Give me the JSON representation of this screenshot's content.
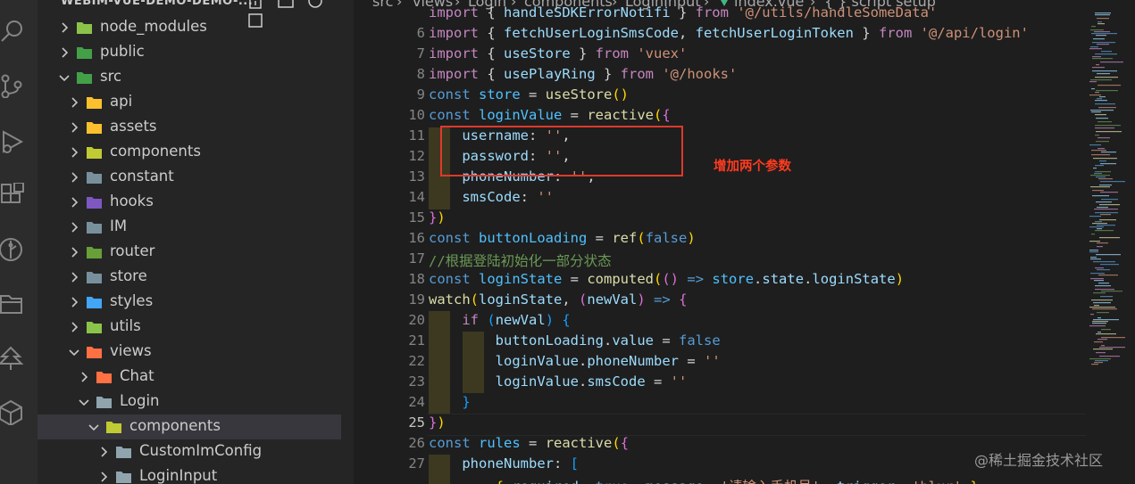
{
  "activity_bar": [
    "search-icon",
    "source-control-icon",
    "run-debug-icon",
    "extensions-icon",
    "git-graph-icon",
    "folder-icon",
    "tree-icon",
    "box-icon"
  ],
  "explorer": {
    "title": "WEBIM-VUE-DEMO-DEMO-...",
    "items": [
      {
        "label": "node_modules",
        "indent": 0,
        "chevron": "right",
        "icon": "#8bc34a"
      },
      {
        "label": "public",
        "indent": 0,
        "chevron": "right",
        "icon": "#43a047"
      },
      {
        "label": "src",
        "indent": 0,
        "chevron": "down",
        "icon": "#43a047"
      },
      {
        "label": "api",
        "indent": 1,
        "chevron": "right",
        "icon": "#fbc02d"
      },
      {
        "label": "assets",
        "indent": 1,
        "chevron": "right",
        "icon": "#fbc02d"
      },
      {
        "label": "components",
        "indent": 1,
        "chevron": "right",
        "icon": "#c0ca33"
      },
      {
        "label": "constant",
        "indent": 1,
        "chevron": "right",
        "icon": "#78909c"
      },
      {
        "label": "hooks",
        "indent": 1,
        "chevron": "right",
        "icon": "#7e57c2"
      },
      {
        "label": "IM",
        "indent": 1,
        "chevron": "right",
        "icon": "#78909c"
      },
      {
        "label": "router",
        "indent": 1,
        "chevron": "right",
        "icon": "#689f38"
      },
      {
        "label": "store",
        "indent": 1,
        "chevron": "right",
        "icon": "#78909c"
      },
      {
        "label": "styles",
        "indent": 1,
        "chevron": "right",
        "icon": "#42a5f5"
      },
      {
        "label": "utils",
        "indent": 1,
        "chevron": "right",
        "icon": "#8bc34a"
      },
      {
        "label": "views",
        "indent": 1,
        "chevron": "down",
        "icon": "#ff7043"
      },
      {
        "label": "Chat",
        "indent": 2,
        "chevron": "right",
        "icon": "#ff7043"
      },
      {
        "label": "Login",
        "indent": 2,
        "chevron": "down",
        "icon": "#90a4ae"
      },
      {
        "label": "components",
        "indent": 3,
        "chevron": "down",
        "icon": "#c0ca33",
        "selected": true
      },
      {
        "label": "CustomImConfig",
        "indent": 4,
        "chevron": "right",
        "icon": "#90a4ae"
      },
      {
        "label": "LoginInput",
        "indent": 4,
        "chevron": "right",
        "icon": "#90a4ae"
      }
    ]
  },
  "breadcrumb": [
    "src",
    "views",
    "Login",
    "components",
    "LoginInput",
    "index.vue",
    "{ } script setup"
  ],
  "code": {
    "active_line": 25,
    "lines": [
      {
        "n": "",
        "tokens": [
          [
            "kw2",
            "import"
          ],
          [
            "pun",
            " { "
          ],
          [
            "var",
            "handleSDKErrorNotifi"
          ],
          [
            "pun",
            " } "
          ],
          [
            "kw2",
            "from"
          ],
          [
            "pun",
            " "
          ],
          [
            "str",
            "'@/utils/handleSomeData'"
          ]
        ]
      },
      {
        "n": "6",
        "tokens": [
          [
            "kw2",
            "import"
          ],
          [
            "pun",
            " { "
          ],
          [
            "var",
            "fetchUserLoginSmsCode"
          ],
          [
            "pun",
            ", "
          ],
          [
            "var",
            "fetchUserLoginToken"
          ],
          [
            "pun",
            " } "
          ],
          [
            "kw2",
            "from"
          ],
          [
            "pun",
            " "
          ],
          [
            "str",
            "'@/api/login'"
          ]
        ]
      },
      {
        "n": "7",
        "tokens": [
          [
            "kw2",
            "import"
          ],
          [
            "pun",
            " { "
          ],
          [
            "var",
            "useStore"
          ],
          [
            "pun",
            " } "
          ],
          [
            "kw2",
            "from"
          ],
          [
            "pun",
            " "
          ],
          [
            "str",
            "'vuex'"
          ]
        ]
      },
      {
        "n": "8",
        "tokens": [
          [
            "kw2",
            "import"
          ],
          [
            "pun",
            " { "
          ],
          [
            "var",
            "usePlayRing"
          ],
          [
            "pun",
            " } "
          ],
          [
            "kw2",
            "from"
          ],
          [
            "pun",
            " "
          ],
          [
            "str",
            "'@/hooks'"
          ]
        ]
      },
      {
        "n": "9",
        "tokens": [
          [
            "kw",
            "const"
          ],
          [
            "pun",
            " "
          ],
          [
            "cst",
            "store"
          ],
          [
            "pun",
            " = "
          ],
          [
            "fn",
            "useStore"
          ],
          [
            "brk",
            "()"
          ]
        ]
      },
      {
        "n": "10",
        "tokens": [
          [
            "kw",
            "const"
          ],
          [
            "pun",
            " "
          ],
          [
            "cst",
            "loginValue"
          ],
          [
            "pun",
            " = "
          ],
          [
            "fn",
            "reactive"
          ],
          [
            "brk",
            "("
          ],
          [
            "brk2",
            "{"
          ]
        ]
      },
      {
        "n": "11",
        "tokens": [
          [
            "pun",
            "    "
          ],
          [
            "var",
            "username"
          ],
          [
            "pun",
            ": "
          ],
          [
            "str",
            "''"
          ],
          [
            "pun",
            ","
          ]
        ]
      },
      {
        "n": "12",
        "tokens": [
          [
            "pun",
            "    "
          ],
          [
            "var",
            "password"
          ],
          [
            "pun",
            ": "
          ],
          [
            "str",
            "''"
          ],
          [
            "pun",
            ","
          ]
        ]
      },
      {
        "n": "13",
        "tokens": [
          [
            "pun",
            "    "
          ],
          [
            "var",
            "phoneNumber"
          ],
          [
            "pun",
            ": "
          ],
          [
            "str",
            "''"
          ],
          [
            "pun",
            ","
          ]
        ]
      },
      {
        "n": "14",
        "tokens": [
          [
            "pun",
            "    "
          ],
          [
            "var",
            "smsCode"
          ],
          [
            "pun",
            ": "
          ],
          [
            "str",
            "''"
          ]
        ]
      },
      {
        "n": "15",
        "tokens": [
          [
            "brk2",
            "}"
          ],
          [
            "brk",
            ")"
          ]
        ]
      },
      {
        "n": "16",
        "tokens": [
          [
            "kw",
            "const"
          ],
          [
            "pun",
            " "
          ],
          [
            "cst",
            "buttonLoading"
          ],
          [
            "pun",
            " = "
          ],
          [
            "fn",
            "ref"
          ],
          [
            "brk",
            "("
          ],
          [
            "kw",
            "false"
          ],
          [
            "brk",
            ")"
          ]
        ]
      },
      {
        "n": "17",
        "tokens": [
          [
            "cmt",
            "//根据登陆初始化一部分状态"
          ]
        ]
      },
      {
        "n": "18",
        "tokens": [
          [
            "kw",
            "const"
          ],
          [
            "pun",
            " "
          ],
          [
            "cst",
            "loginState"
          ],
          [
            "pun",
            " = "
          ],
          [
            "fn",
            "computed"
          ],
          [
            "brk",
            "("
          ],
          [
            "brk2",
            "()"
          ],
          [
            "pun",
            " "
          ],
          [
            "kw",
            "=>"
          ],
          [
            "pun",
            " "
          ],
          [
            "cst",
            "store"
          ],
          [
            "pun",
            "."
          ],
          [
            "var",
            "state"
          ],
          [
            "pun",
            "."
          ],
          [
            "var",
            "loginState"
          ],
          [
            "brk",
            ")"
          ]
        ]
      },
      {
        "n": "19",
        "tokens": [
          [
            "fn",
            "watch"
          ],
          [
            "brk",
            "("
          ],
          [
            "var",
            "loginState"
          ],
          [
            "pun",
            ", "
          ],
          [
            "brk2",
            "("
          ],
          [
            "var",
            "newVal"
          ],
          [
            "brk2",
            ")"
          ],
          [
            "pun",
            " "
          ],
          [
            "kw",
            "=>"
          ],
          [
            "pun",
            " "
          ],
          [
            "brk2",
            "{"
          ]
        ]
      },
      {
        "n": "20",
        "tokens": [
          [
            "pun",
            "    "
          ],
          [
            "kw2",
            "if"
          ],
          [
            "pun",
            " "
          ],
          [
            "brk3",
            "("
          ],
          [
            "var",
            "newVal"
          ],
          [
            "brk3",
            ")"
          ],
          [
            "pun",
            " "
          ],
          [
            "brk3",
            "{"
          ]
        ]
      },
      {
        "n": "21",
        "tokens": [
          [
            "pun",
            "        "
          ],
          [
            "var",
            "buttonLoading"
          ],
          [
            "pun",
            "."
          ],
          [
            "var",
            "value"
          ],
          [
            "pun",
            " = "
          ],
          [
            "kw",
            "false"
          ]
        ]
      },
      {
        "n": "22",
        "tokens": [
          [
            "pun",
            "        "
          ],
          [
            "var",
            "loginValue"
          ],
          [
            "pun",
            "."
          ],
          [
            "var",
            "phoneNumber"
          ],
          [
            "pun",
            " = "
          ],
          [
            "str",
            "''"
          ]
        ]
      },
      {
        "n": "23",
        "tokens": [
          [
            "pun",
            "        "
          ],
          [
            "var",
            "loginValue"
          ],
          [
            "pun",
            "."
          ],
          [
            "var",
            "smsCode"
          ],
          [
            "pun",
            " = "
          ],
          [
            "str",
            "''"
          ]
        ]
      },
      {
        "n": "24",
        "tokens": [
          [
            "pun",
            "    "
          ],
          [
            "brk3",
            "}"
          ]
        ]
      },
      {
        "n": "25",
        "tokens": [
          [
            "brk2",
            "}"
          ],
          [
            "brk",
            ")"
          ]
        ]
      },
      {
        "n": "26",
        "tokens": [
          [
            "kw",
            "const"
          ],
          [
            "pun",
            " "
          ],
          [
            "cst",
            "rules"
          ],
          [
            "pun",
            " = "
          ],
          [
            "fn",
            "reactive"
          ],
          [
            "brk",
            "("
          ],
          [
            "brk2",
            "{"
          ]
        ]
      },
      {
        "n": "27",
        "tokens": [
          [
            "pun",
            "    "
          ],
          [
            "var",
            "phoneNumber"
          ],
          [
            "pun",
            ": "
          ],
          [
            "brk3",
            "["
          ]
        ]
      },
      {
        "n": "",
        "tokens": [
          [
            "pun",
            "        "
          ],
          [
            "brk",
            "{"
          ],
          [
            "pun",
            " "
          ],
          [
            "var",
            "required"
          ],
          [
            "pun",
            ": "
          ],
          [
            "kw",
            "true"
          ],
          [
            "pun",
            ", "
          ],
          [
            "var",
            "message"
          ],
          [
            "pun",
            ": "
          ],
          [
            "str",
            "'请输入手机号'"
          ],
          [
            "pun",
            ", "
          ],
          [
            "var",
            "trigger"
          ],
          [
            "pun",
            ": "
          ],
          [
            "str",
            "'blur'"
          ],
          [
            "pun",
            " "
          ],
          [
            "brk",
            "}"
          ],
          [
            "pun",
            ","
          ]
        ]
      }
    ]
  },
  "annotation": {
    "text": "增加两个参数",
    "color": "#e0392b"
  },
  "watermark": "@稀土掘金技术社区"
}
